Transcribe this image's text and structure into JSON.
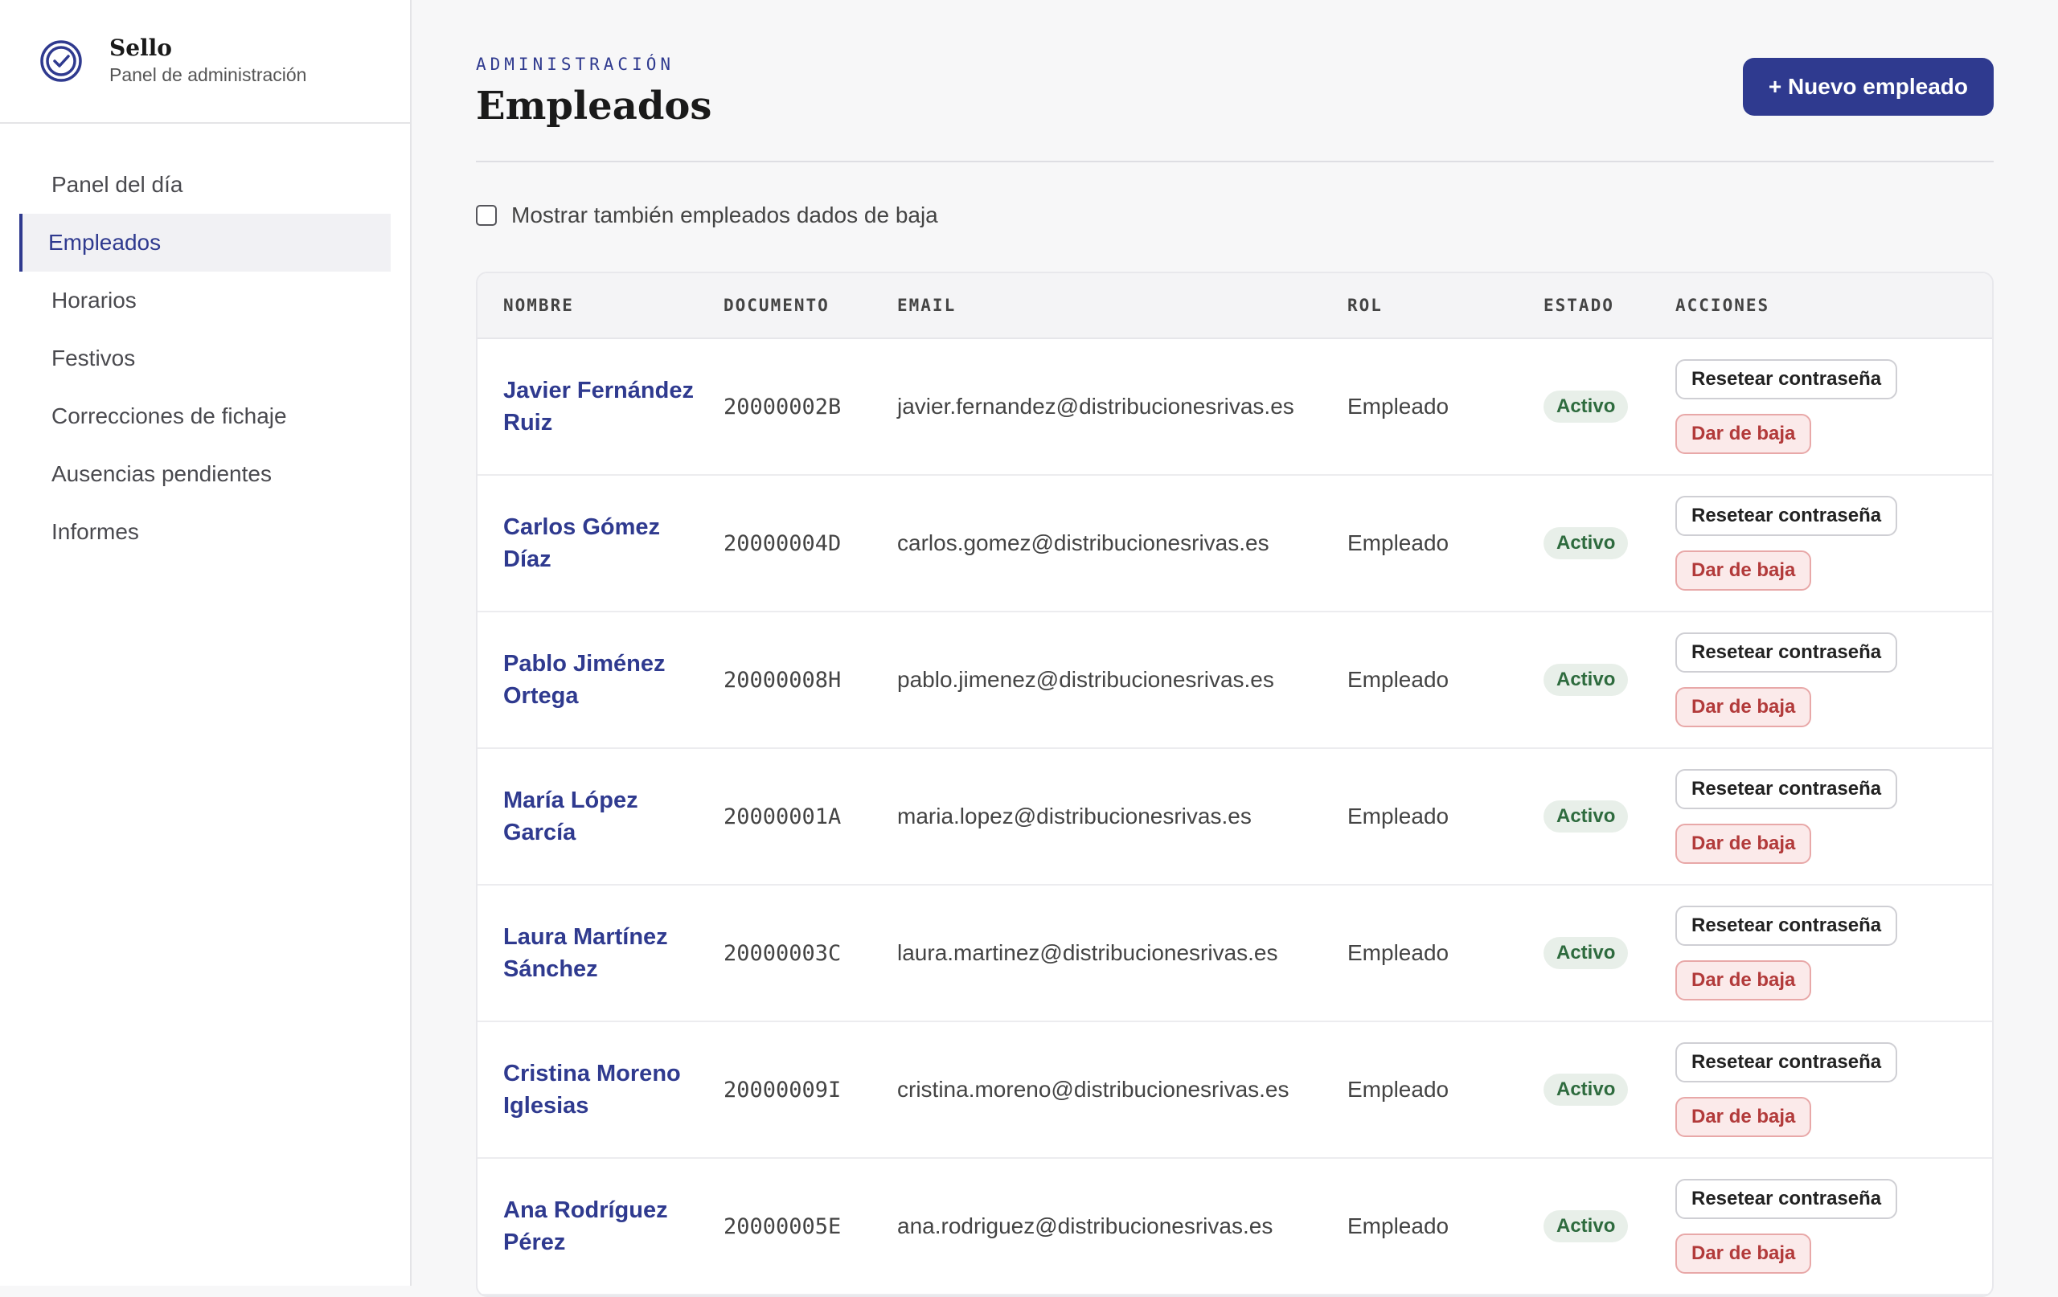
{
  "brand": {
    "name": "Sello",
    "subtitle": "Panel de administración"
  },
  "nav": {
    "items": [
      {
        "label": "Panel del día",
        "active": false
      },
      {
        "label": "Empleados",
        "active": true
      },
      {
        "label": "Horarios",
        "active": false
      },
      {
        "label": "Festivos",
        "active": false
      },
      {
        "label": "Correcciones de fichaje",
        "active": false
      },
      {
        "label": "Ausencias pendientes",
        "active": false
      },
      {
        "label": "Informes",
        "active": false
      }
    ]
  },
  "header": {
    "eyebrow": "ADMINISTRACIÓN",
    "title": "Empleados",
    "new_button": "+ Nuevo empleado"
  },
  "filter": {
    "label": "Mostrar también empleados dados de baja",
    "checked": false
  },
  "table": {
    "columns": [
      "NOMBRE",
      "DOCUMENTO",
      "EMAIL",
      "ROL",
      "ESTADO",
      "ACCIONES"
    ],
    "reset_label": "Resetear contraseña",
    "baja_label": "Dar de baja",
    "rows": [
      {
        "name": "Javier Fernández Ruiz",
        "doc": "20000002B",
        "email": "javier.fernandez@distribucionesrivas.es",
        "rol": "Empleado",
        "estado": "Activo"
      },
      {
        "name": "Carlos Gómez Díaz",
        "doc": "20000004D",
        "email": "carlos.gomez@distribucionesrivas.es",
        "rol": "Empleado",
        "estado": "Activo"
      },
      {
        "name": "Pablo Jiménez Ortega",
        "doc": "20000008H",
        "email": "pablo.jimenez@distribucionesrivas.es",
        "rol": "Empleado",
        "estado": "Activo"
      },
      {
        "name": "María López García",
        "doc": "20000001A",
        "email": "maria.lopez@distribucionesrivas.es",
        "rol": "Empleado",
        "estado": "Activo"
      },
      {
        "name": "Laura Martínez Sánchez",
        "doc": "20000003C",
        "email": "laura.martinez@distribucionesrivas.es",
        "rol": "Empleado",
        "estado": "Activo"
      },
      {
        "name": "Cristina Moreno Iglesias",
        "doc": "20000009I",
        "email": "cristina.moreno@distribucionesrivas.es",
        "rol": "Empleado",
        "estado": "Activo"
      },
      {
        "name": "Ana Rodríguez Pérez",
        "doc": "20000005E",
        "email": "ana.rodriguez@distribucionesrivas.es",
        "rol": "Empleado",
        "estado": "Activo"
      }
    ]
  },
  "colors": {
    "accent": "#2f3a8f",
    "active_badge_bg": "#e8efe9",
    "active_badge_text": "#2e6b3e",
    "danger": "#b23a3a"
  }
}
